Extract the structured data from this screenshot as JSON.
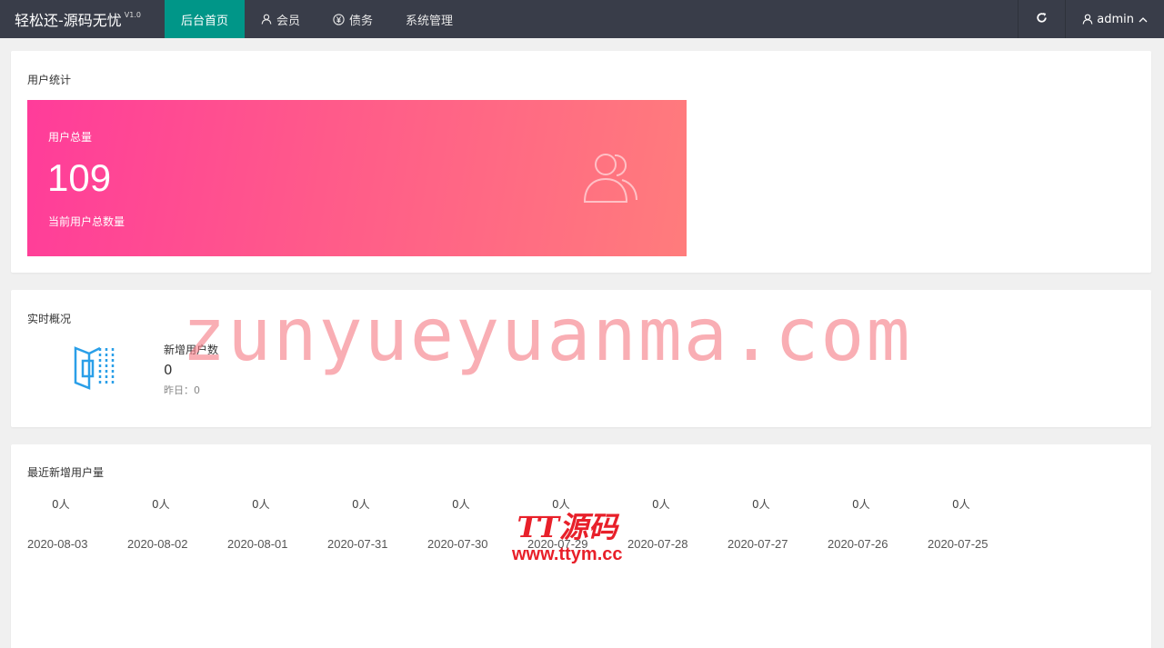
{
  "header": {
    "brand": "轻松还-源码无忧",
    "version": "V1.0",
    "nav": [
      {
        "label": "后台首页",
        "active": true
      },
      {
        "label": "会员",
        "icon": "user-icon"
      },
      {
        "label": "债务",
        "icon": "yen-icon"
      },
      {
        "label": "系统管理"
      }
    ],
    "user": "admin"
  },
  "user_stats": {
    "title": "用户统计",
    "label": "用户总量",
    "value": "109",
    "sub": "当前用户总数量"
  },
  "realtime": {
    "title": "实时概况",
    "label": "新增用户数",
    "value": "0",
    "yesterday": "昨日：0"
  },
  "recent": {
    "title": "最近新增用户量",
    "items": [
      {
        "count": "0人",
        "date": "2020-08-03"
      },
      {
        "count": "0人",
        "date": "2020-08-02"
      },
      {
        "count": "0人",
        "date": "2020-08-01"
      },
      {
        "count": "0人",
        "date": "2020-07-31"
      },
      {
        "count": "0人",
        "date": "2020-07-30"
      },
      {
        "count": "0人",
        "date": "2020-07-29"
      },
      {
        "count": "0人",
        "date": "2020-07-28"
      },
      {
        "count": "0人",
        "date": "2020-07-27"
      },
      {
        "count": "0人",
        "date": "2020-07-26"
      },
      {
        "count": "0人",
        "date": "2020-07-25"
      }
    ]
  },
  "watermarks": {
    "main": "zunyueyuanma.com",
    "logo": "TT源码",
    "url": "www.ttym.cc"
  },
  "colors": {
    "topbar": "#393d49",
    "active_nav": "#009688",
    "stat_gradient_start": "#ff3c9a",
    "stat_gradient_end": "#ff7c7c",
    "icon_blue": "#1e90ff"
  }
}
